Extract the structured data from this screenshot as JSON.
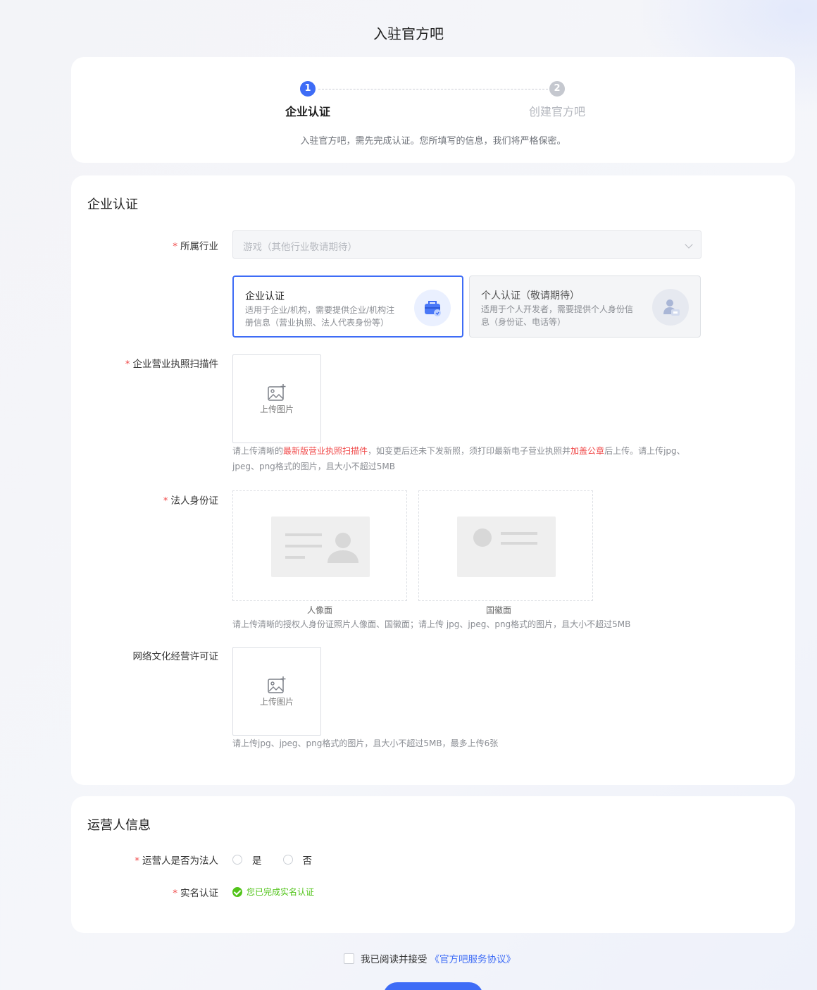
{
  "page": {
    "title": "入驻官方吧"
  },
  "steps": {
    "items": [
      {
        "num": "1",
        "label": "企业认证"
      },
      {
        "num": "2",
        "label": "创建官方吧"
      }
    ],
    "description": "入驻官方吧，需先完成认证。您所填写的信息，我们将严格保密。"
  },
  "auth": {
    "title": "企业认证",
    "required_mark": "*",
    "industry": {
      "label": "所属行业",
      "value": "游戏（其他行业敬请期待）"
    },
    "types": [
      {
        "title": "企业认证",
        "desc": "适用于企业/机构，需要提供企业/机构注册信息（营业执照、法人代表身份等）",
        "icon": "enterprise-toolbox-icon"
      },
      {
        "title": "个人认证（敬请期待）",
        "desc": "适用于个人开发者，需要提供个人身份信息（身份证、电话等）",
        "icon": "personal-id-icon"
      }
    ],
    "license": {
      "label": "企业营业执照扫描件",
      "upload_text": "上传图片",
      "hint_1": "请上传清晰的",
      "hint_hl_1": "最新版营业执照扫描件",
      "hint_2": "，如变更后还未下发新照，须打印最新电子营业执照并",
      "hint_hl_2": "加盖公章",
      "hint_3": "后上传。请上传jpg、jpeg、png格式的图片，且大小不超过5MB"
    },
    "id_card": {
      "label": "法人身份证",
      "front_caption": "人像面",
      "back_caption": "国徽面",
      "hint": "请上传清晰的授权人身份证照片人像面、国徽面；请上传 jpg、jpeg、png格式的图片，且大小不超过5MB"
    },
    "culture_license": {
      "label": "网络文化经营许可证",
      "upload_text": "上传图片",
      "hint": "请上传jpg、jpeg、png格式的图片，且大小不超过5MB，最多上传6张"
    }
  },
  "operator": {
    "title": "运营人信息",
    "is_legal": {
      "label": "运营人是否为法人",
      "options": [
        "是",
        "否"
      ]
    },
    "real_name": {
      "label": "实名认证",
      "status": "您已完成实名认证"
    }
  },
  "agreement": {
    "text": "我已阅读并接受",
    "link": "《官方吧服务协议》"
  },
  "colors": {
    "primary": "#3e6cf6",
    "required": "#f04848",
    "success": "#52c41a"
  }
}
